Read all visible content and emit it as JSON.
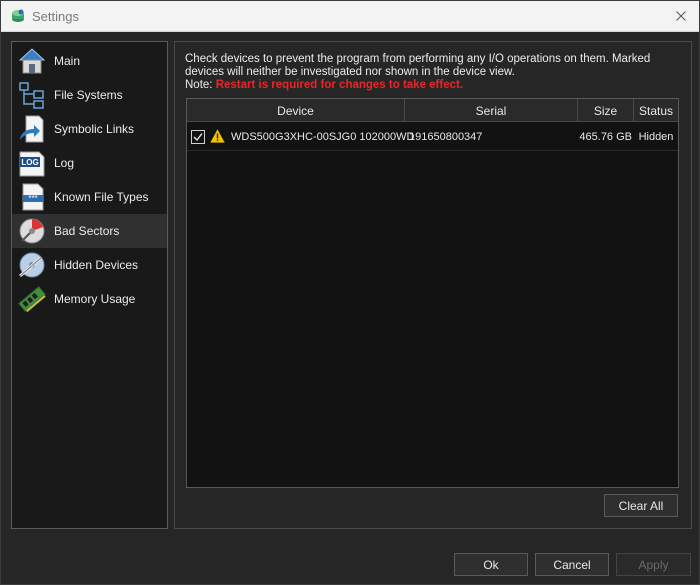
{
  "window": {
    "title": "Settings"
  },
  "sidebar": {
    "items": [
      {
        "label": "Main",
        "icon": "house-icon"
      },
      {
        "label": "File Systems",
        "icon": "file-tree-icon"
      },
      {
        "label": "Symbolic Links",
        "icon": "symlink-icon"
      },
      {
        "label": "Log",
        "icon": "log-icon"
      },
      {
        "label": "Known File Types",
        "icon": "file-types-icon"
      },
      {
        "label": "Bad Sectors",
        "icon": "disk-bad-sector-icon"
      },
      {
        "label": "Hidden Devices",
        "icon": "hidden-disk-icon"
      },
      {
        "label": "Memory Usage",
        "icon": "memory-chip-icon"
      }
    ],
    "active": "Bad Sectors"
  },
  "panel": {
    "description": "Check devices to prevent the program from performing any I/O operations on them. Marked devices will neither be investigated nor shown in the device view.",
    "note_prefix": "Note:",
    "note_warning": "Restart is required for changes to take effect.",
    "columns": {
      "device": "Device",
      "serial": "Serial",
      "size": "Size",
      "status": "Status"
    },
    "rows": [
      {
        "checked": true,
        "warning": true,
        "device": "WDS500G3XHC-00SJG0 102000WD",
        "serial": "191650800347",
        "size": "465.76 GB",
        "status": "Hidden"
      }
    ],
    "clear_all": "Clear All"
  },
  "buttons": {
    "ok": "Ok",
    "cancel": "Cancel",
    "apply": "Apply"
  },
  "colors": {
    "warning_text": "#e8262a",
    "background": "#262626",
    "list_background": "#121212"
  }
}
